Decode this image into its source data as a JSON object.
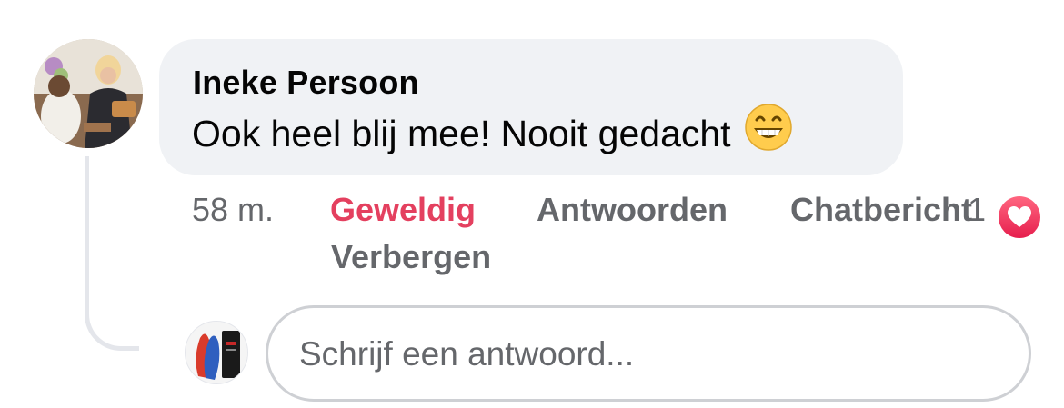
{
  "comment": {
    "author": "Ineke Persoon",
    "text": "Ook heel blij mee! Nooit gedacht",
    "emoji": "grinning-face-with-smiling-eyes",
    "avatar_icon": "user-photo-icon"
  },
  "actions": {
    "timestamp": "58 m.",
    "reaction_label": "Geweldig",
    "reply_label": "Antwoorden",
    "message_label": "Chatbericht",
    "hide_label": "Verbergen",
    "reaction_count": "1",
    "reaction_icon": "heart-icon"
  },
  "reply_box": {
    "placeholder": "Schrijf een antwoord...",
    "avatar_icon": "insole-product-photo-icon"
  },
  "colors": {
    "bubble_background": "#f0f2f5",
    "primary_text": "#050505",
    "secondary_text": "#65676b",
    "reaction_active": "#e4405f",
    "heart": "#f33e58",
    "divider": "#e4e6eb"
  }
}
